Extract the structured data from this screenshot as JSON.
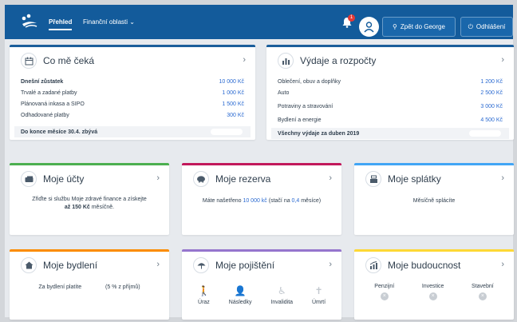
{
  "topbar": {
    "nav": [
      {
        "label": "Přehled"
      },
      {
        "label": "Finanční oblasti"
      }
    ],
    "bell_badge": "1",
    "back_button": "Zpět do George",
    "logout_button": "Odhlášení"
  },
  "cards": {
    "ceka": {
      "title": "Co mě čeká",
      "rows": [
        {
          "label": "Dnešní zůstatek",
          "value": "10 000 Kč"
        },
        {
          "label": "Trvalé a zadané platby",
          "value": "1 000 Kč"
        },
        {
          "label": "Plánovaná inkasa a SIPO",
          "value": "1 500 Kč"
        },
        {
          "label": "Odhadované platby",
          "value": "300 Kč"
        }
      ],
      "footer": "Do konce měsíce 30.4. zbývá"
    },
    "vydaje": {
      "title": "Výdaje a rozpočty",
      "rows": [
        {
          "label": "Oblečení, obuv a doplňky",
          "value": "1 200 Kč"
        },
        {
          "label": "Auto",
          "value": "2 500 Kč"
        },
        {
          "label": "Potraviny a stravování",
          "value": "3 000 Kč"
        },
        {
          "label": "Bydlení a energie",
          "value": "4 500 Kč"
        }
      ],
      "footer": "Všechny výdaje za duben 2019"
    },
    "ucty": {
      "title": "Moje účty",
      "text_1": "Zřiďte si službu Moje zdravé finance a získejte",
      "text_2_bold": "až 150 Kč",
      "text_2_rest": " měsíčně."
    },
    "rezerva": {
      "title": "Moje rezerva",
      "text_1": "Máte našetřeno ",
      "amount": "10 000 kč",
      "text_2": " (stačí na ",
      "months": "0,4",
      "text_3": " měsíce)"
    },
    "splatky": {
      "title": "Moje splátky",
      "text": "Měsíčně splácíte"
    },
    "bydleni": {
      "title": "Moje bydlení",
      "text_1": "Za bydlení platíte",
      "text_2": "(5 % z příjmů)"
    },
    "pojisteni": {
      "title": "Moje pojištění",
      "items": [
        {
          "label": "Úraz",
          "icon": "person-falling-icon"
        },
        {
          "label": "Následky",
          "icon": "person-standing-icon"
        },
        {
          "label": "Invalidita",
          "icon": "wheelchair-icon"
        },
        {
          "label": "Úmrtí",
          "icon": "grave-cross-icon"
        }
      ]
    },
    "budoucnost": {
      "title": "Moje budoucnost",
      "items": [
        {
          "label": "Penzijní"
        },
        {
          "label": "Investice"
        },
        {
          "label": "Stavební"
        }
      ]
    }
  },
  "colors": {
    "topbar": "#135b9b",
    "ucty": "#4caf50",
    "rezerva": "#c2185b",
    "splatky": "#42a5f5",
    "bydleni": "#fb8c00",
    "pojisteni": "#9575cd",
    "budoucnost": "#fdd835",
    "value_blue": "#2a6ad1"
  }
}
